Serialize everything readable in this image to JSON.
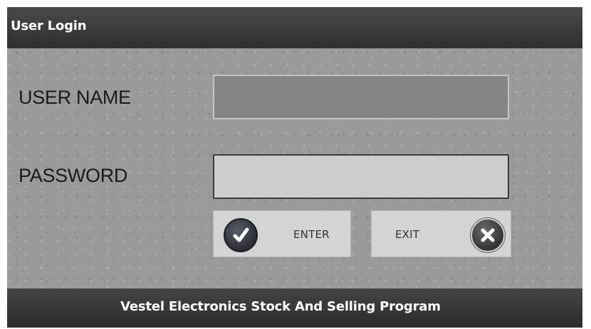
{
  "window": {
    "title": "User Login"
  },
  "form": {
    "username": {
      "label": "USER NAME",
      "value": "",
      "placeholder": ""
    },
    "password": {
      "label": "PASSWORD",
      "value": "",
      "placeholder": ""
    }
  },
  "buttons": {
    "enter": {
      "label": "ENTER",
      "icon": "check-icon"
    },
    "exit": {
      "label": "EXIT",
      "icon": "close-icon"
    }
  },
  "statusbar": {
    "text": "Vestel Electronics Stock And Selling Program"
  },
  "colors": {
    "background": "#9a9a9a",
    "bar": "#333333",
    "button": "#d4d4d4",
    "icon_enter": "#2c2e36",
    "icon_exit": "#333333"
  }
}
